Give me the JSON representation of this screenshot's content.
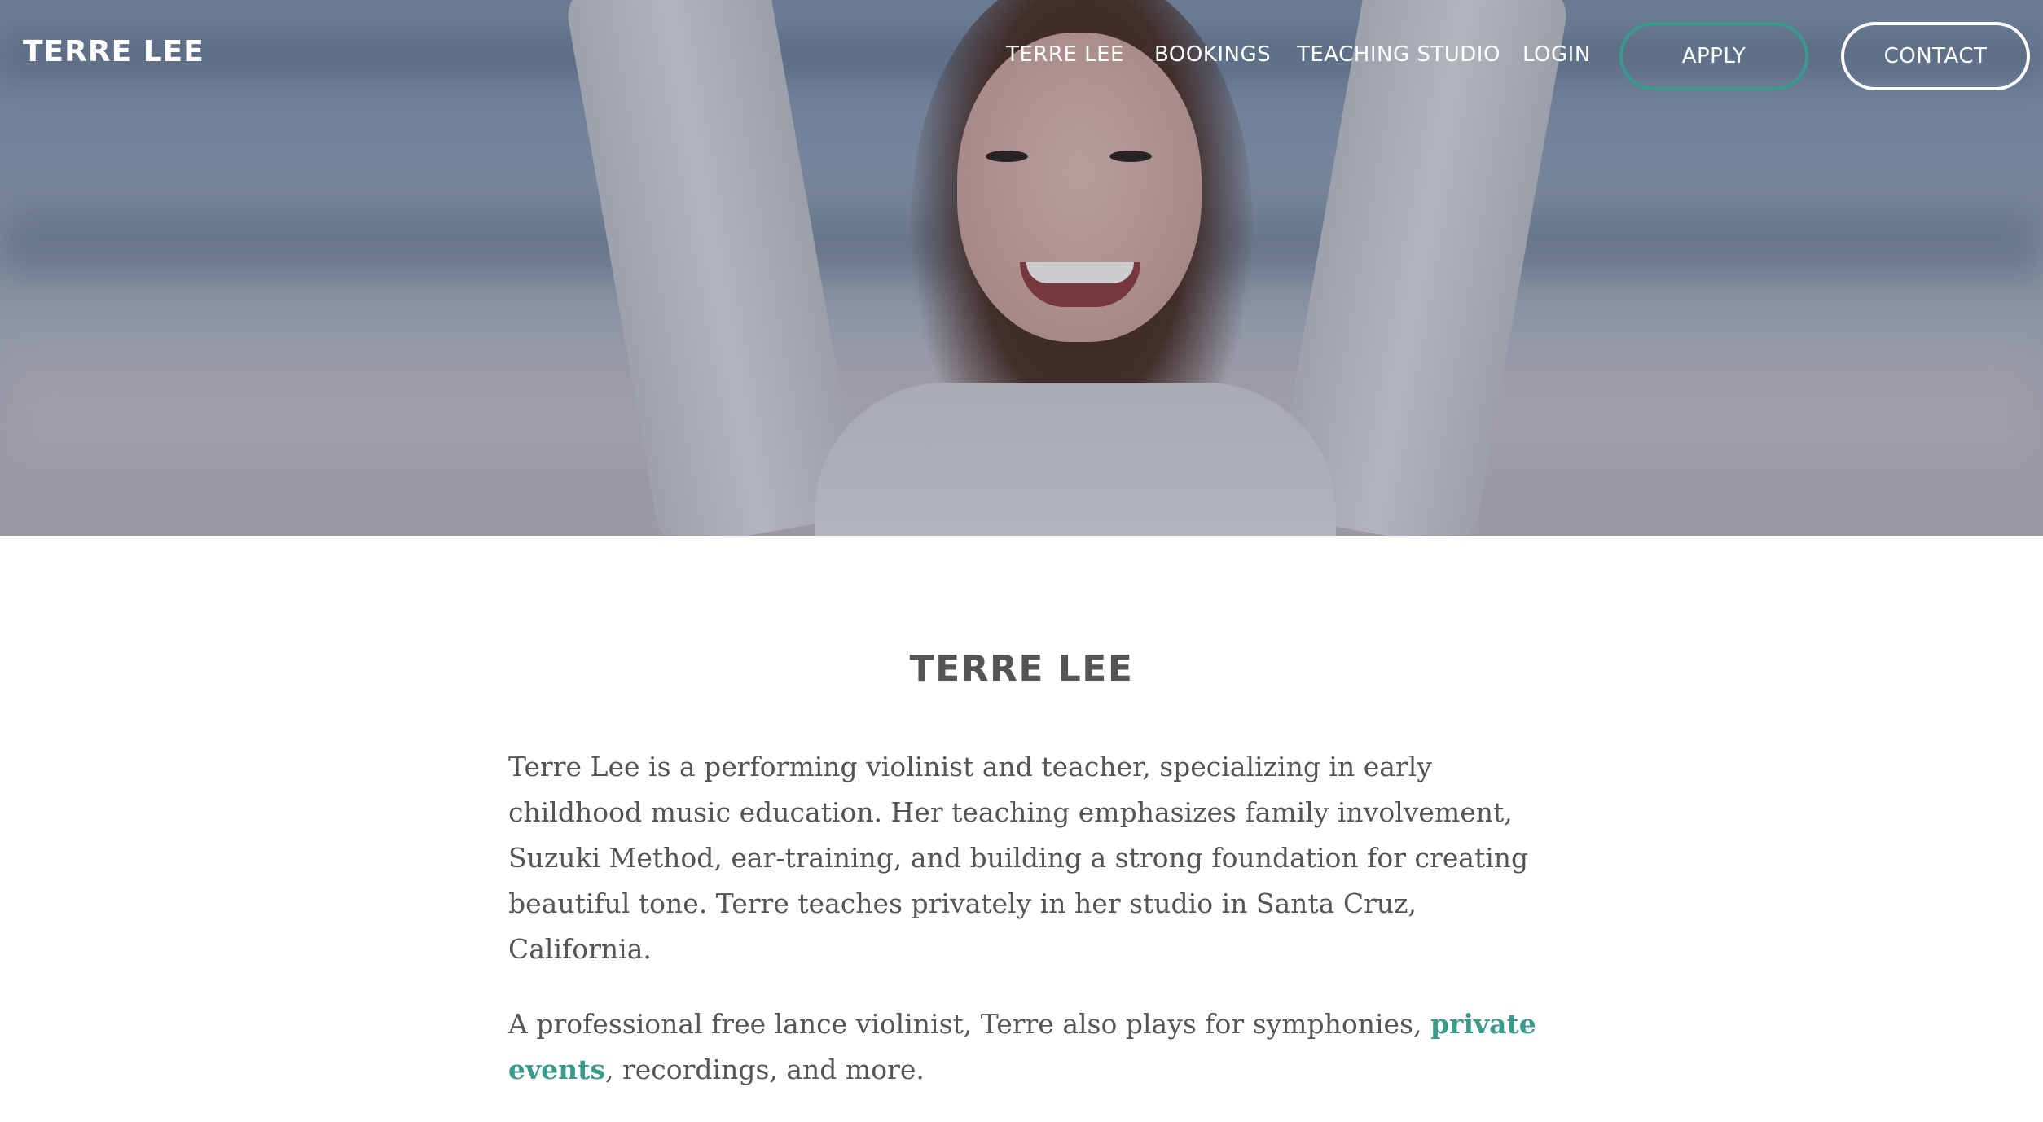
{
  "header": {
    "brand": "TERRE LEE",
    "nav": [
      {
        "label": "TERRE LEE"
      },
      {
        "label": "BOOKINGS"
      },
      {
        "label": "TEACHING STUDIO"
      },
      {
        "label": "LOGIN"
      }
    ],
    "apply_label": "APPLY",
    "contact_label": "CONTACT",
    "accent_color": "#3a9a8c"
  },
  "main": {
    "title": "TERRE LEE",
    "para1": "Terre Lee is a performing violinist and teacher, specializing in early childhood music education. Her teaching emphasizes family involvement, Suzuki Method, ear-training, and building a strong foundation for creating beautiful tone. Terre teaches privately in her studio in Santa Cruz, California.",
    "para2_before": "A professional free lance violinist, Terre also plays for symphonies, ",
    "para2_link": "private events",
    "para2_after": ", recordings, and more."
  }
}
